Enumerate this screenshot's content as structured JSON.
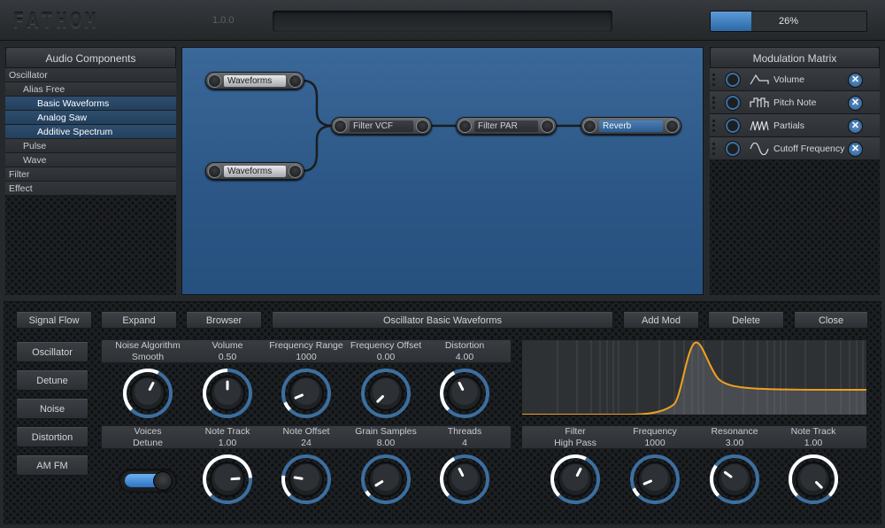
{
  "header": {
    "logo_text": "FATHOM",
    "version": "1.0.0",
    "cpu_percent": 26,
    "cpu_text": "26%"
  },
  "audio_components": {
    "title": "Audio Components",
    "items": [
      {
        "label": "Oscillator",
        "level": 1,
        "selected": false
      },
      {
        "label": "Alias Free",
        "level": 2,
        "selected": false
      },
      {
        "label": "Basic Waveforms",
        "level": 3,
        "selected": true
      },
      {
        "label": "Analog Saw",
        "level": 3,
        "selected": true
      },
      {
        "label": "Additive Spectrum",
        "level": 3,
        "selected": true
      },
      {
        "label": "Pulse",
        "level": 2,
        "selected": false
      },
      {
        "label": "Wave",
        "level": 2,
        "selected": false
      },
      {
        "label": "Filter",
        "level": 1,
        "selected": false
      },
      {
        "label": "Effect",
        "level": 1,
        "selected": false
      }
    ]
  },
  "modulation_matrix": {
    "title": "Modulation Matrix",
    "items": [
      {
        "label": "Volume",
        "icon": "envelope-icon"
      },
      {
        "label": "Pitch Note",
        "icon": "note-steps-icon"
      },
      {
        "label": "Partials",
        "icon": "partials-icon"
      },
      {
        "label": "Cutoff Frequency",
        "icon": "sine-wave-icon"
      }
    ],
    "remove_glyph": "✕"
  },
  "signal_flow": {
    "nodes": [
      {
        "id": "wave1",
        "label": "Waveforms",
        "style": "light"
      },
      {
        "id": "wave2",
        "label": "Waveforms",
        "style": "light"
      },
      {
        "id": "filter_vcf",
        "label": "Filter VCF",
        "style": "dark"
      },
      {
        "id": "filter_par",
        "label": "Filter PAR",
        "style": "dark"
      },
      {
        "id": "reverb",
        "label": "Reverb",
        "style": "blue"
      }
    ]
  },
  "toolbar": {
    "signal_flow": "Signal Flow",
    "expand": "Expand",
    "browser": "Browser",
    "component_title": "Oscillator Basic Waveforms",
    "add_mod": "Add Mod",
    "delete": "Delete",
    "close": "Close"
  },
  "sections": [
    "Oscillator",
    "Detune",
    "Noise",
    "Distortion",
    "AM FM"
  ],
  "params_row1": [
    {
      "name": "Noise Algorithm",
      "value": "Smooth",
      "level": 0.6
    },
    {
      "name": "Volume",
      "value": "0.50",
      "level": 0.5
    },
    {
      "name": "Frequency Range",
      "value": "1000",
      "level": 0.08
    },
    {
      "name": "Frequency Offset",
      "value": "0.00",
      "level": 0.0
    },
    {
      "name": "Distortion",
      "value": "4.00",
      "level": 0.4
    }
  ],
  "params_row2": [
    {
      "name": "Voices",
      "value": "Detune",
      "control": "toggle"
    },
    {
      "name": "Note Track",
      "value": "1.00",
      "level": 0.82
    },
    {
      "name": "Note Offset",
      "value": "24",
      "level": 0.2
    },
    {
      "name": "Grain Samples",
      "value": "8.00",
      "level": 0.05
    },
    {
      "name": "Threads",
      "value": "4",
      "level": 0.4
    }
  ],
  "filter_params": [
    {
      "name": "Filter",
      "value": "High Pass",
      "level": 0.6
    },
    {
      "name": "Frequency",
      "value": "1000",
      "level": 0.08
    },
    {
      "name": "Resonance",
      "value": "3.00",
      "level": 0.3
    },
    {
      "name": "Note Track",
      "value": "1.00",
      "level": 1.0
    }
  ],
  "colors": {
    "accent": "#3d78b8",
    "knob_ring_active": "#ffffff",
    "curve": "#f0a020",
    "canvas": "#2e5a8a"
  }
}
